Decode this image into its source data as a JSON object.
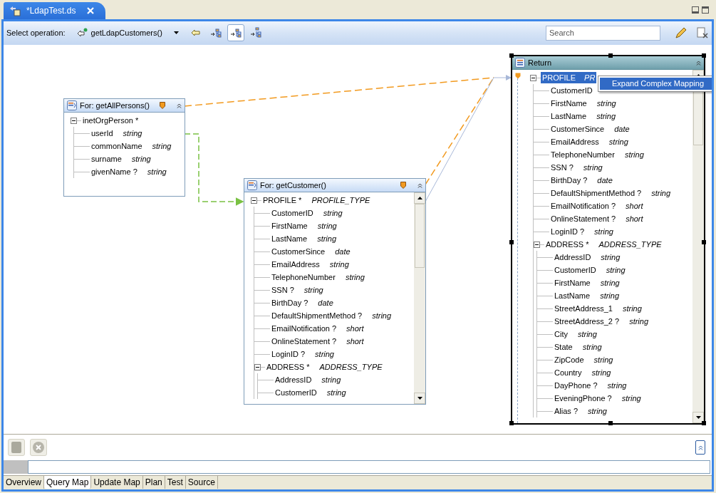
{
  "editor_tab": {
    "title": "*LdapTest.ds"
  },
  "toolbar": {
    "label": "Select operation:",
    "operation": "getLdapCustomers()",
    "tools": [
      {
        "selected": false
      },
      {
        "selected": false
      },
      {
        "selected": true
      },
      {
        "selected": false
      }
    ]
  },
  "search": {
    "placeholder": "Search"
  },
  "nodes": [
    {
      "title": "For: getAllPersons()",
      "kind": "source",
      "tree": [
        {
          "name": "inetOrgPerson *",
          "selected": false,
          "expanded": true,
          "children": [
            {
              "name": "userId",
              "type": "string"
            },
            {
              "name": "commonName",
              "type": "string"
            },
            {
              "name": "surname",
              "type": "string"
            },
            {
              "name": "givenName ?",
              "type": "string"
            }
          ]
        }
      ]
    },
    {
      "title": "For: getCustomer()",
      "kind": "source",
      "tree": [
        {
          "name": "PROFILE *",
          "type": "PROFILE_TYPE",
          "selected": false,
          "expanded": true,
          "children": [
            {
              "name": "CustomerID",
              "type": "string"
            },
            {
              "name": "FirstName",
              "type": "string"
            },
            {
              "name": "LastName",
              "type": "string"
            },
            {
              "name": "CustomerSince",
              "type": "date"
            },
            {
              "name": "EmailAddress",
              "type": "string"
            },
            {
              "name": "TelephoneNumber",
              "type": "string"
            },
            {
              "name": "SSN ?",
              "type": "string"
            },
            {
              "name": "BirthDay ?",
              "type": "date"
            },
            {
              "name": "DefaultShipmentMethod ?",
              "type": "string"
            },
            {
              "name": "EmailNotification ?",
              "type": "short"
            },
            {
              "name": "OnlineStatement ?",
              "type": "short"
            },
            {
              "name": "LoginID ?",
              "type": "string"
            },
            {
              "name": "ADDRESS *",
              "type": "ADDRESS_TYPE",
              "expanded": true,
              "children": [
                {
                  "name": "AddressID",
                  "type": "string"
                },
                {
                  "name": "CustomerID",
                  "type": "string"
                }
              ]
            }
          ]
        }
      ]
    },
    {
      "title": "Return",
      "kind": "return",
      "tree": [
        {
          "name": "PROFILE",
          "type": "PR",
          "selected": true,
          "expanded": true,
          "children": [
            {
              "name": "CustomerID"
            },
            {
              "name": "FirstName",
              "type": "string"
            },
            {
              "name": "LastName",
              "type": "string"
            },
            {
              "name": "CustomerSince",
              "type": "date"
            },
            {
              "name": "EmailAddress",
              "type": "string"
            },
            {
              "name": "TelephoneNumber",
              "type": "string"
            },
            {
              "name": "SSN ?",
              "type": "string"
            },
            {
              "name": "BirthDay ?",
              "type": "date"
            },
            {
              "name": "DefaultShipmentMethod ?",
              "type": "string"
            },
            {
              "name": "EmailNotification ?",
              "type": "short"
            },
            {
              "name": "OnlineStatement ?",
              "type": "short"
            },
            {
              "name": "LoginID ?",
              "type": "string"
            },
            {
              "name": "ADDRESS *",
              "type": "ADDRESS_TYPE",
              "expanded": true,
              "children": [
                {
                  "name": "AddressID",
                  "type": "string"
                },
                {
                  "name": "CustomerID",
                  "type": "string"
                },
                {
                  "name": "FirstName",
                  "type": "string"
                },
                {
                  "name": "LastName",
                  "type": "string"
                },
                {
                  "name": "StreetAddress_1",
                  "type": "string"
                },
                {
                  "name": "StreetAddress_2 ?",
                  "type": "string"
                },
                {
                  "name": "City",
                  "type": "string"
                },
                {
                  "name": "State",
                  "type": "string"
                },
                {
                  "name": "ZipCode",
                  "type": "string"
                },
                {
                  "name": "Country",
                  "type": "string"
                },
                {
                  "name": "DayPhone ?",
                  "type": "string"
                },
                {
                  "name": "EveningPhone ?",
                  "type": "string"
                },
                {
                  "name": "Alias ?",
                  "type": "string"
                }
              ]
            }
          ]
        }
      ]
    }
  ],
  "context_menu": {
    "items": [
      {
        "label": "Expand Complex Mapping",
        "selected": true
      }
    ]
  },
  "bottom_panel": {
    "buttons": [
      {
        "disabled": true
      },
      {
        "disabled": true
      }
    ]
  },
  "bottom_tabs": [
    {
      "label": "Overview",
      "selected": false
    },
    {
      "label": "Query Map",
      "selected": true
    },
    {
      "label": "Update Map",
      "selected": false
    },
    {
      "label": "Plan",
      "selected": false
    },
    {
      "label": "Test",
      "selected": false
    },
    {
      "label": "Source",
      "selected": false
    }
  ]
}
